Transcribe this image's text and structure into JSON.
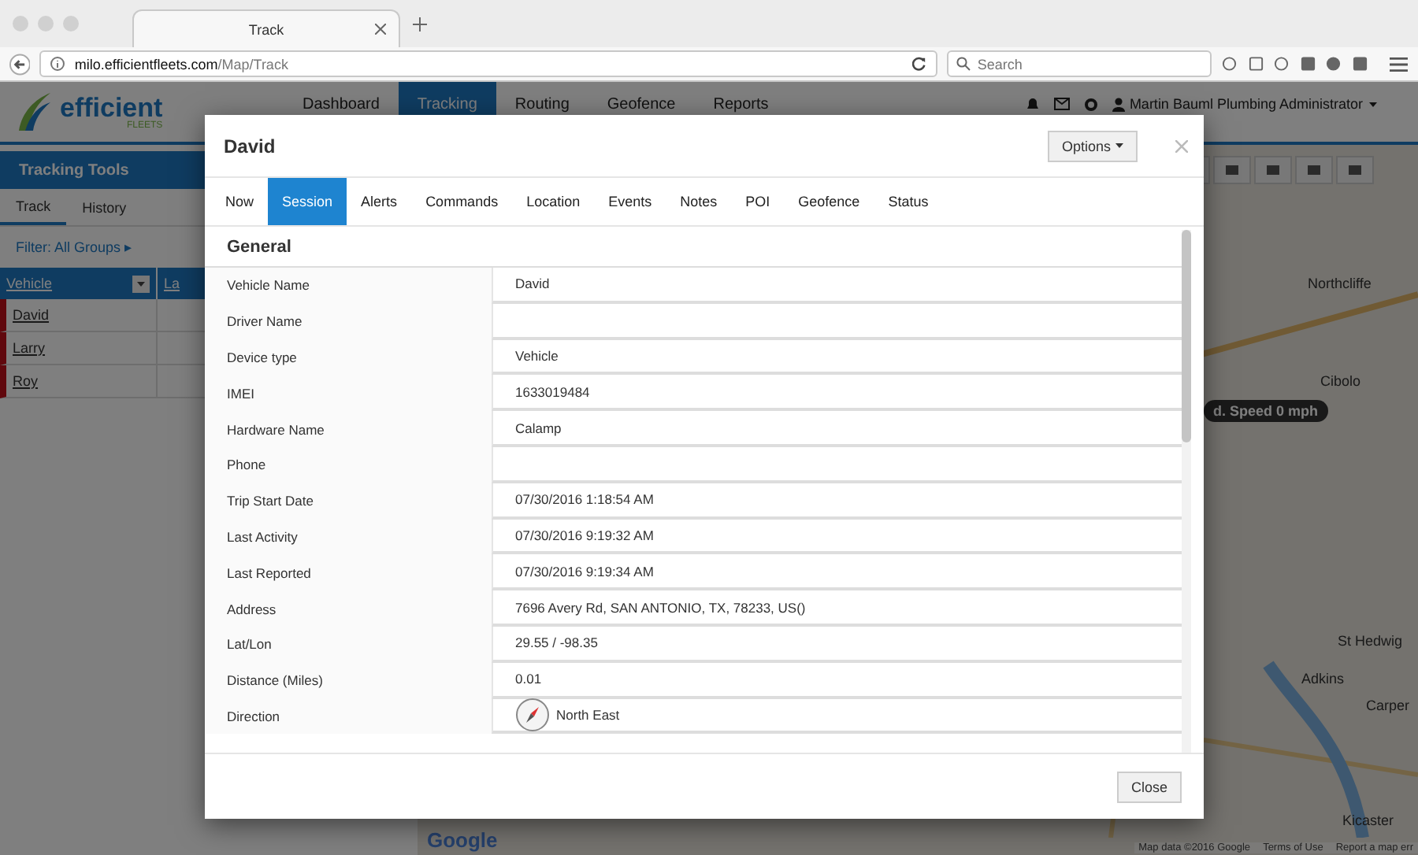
{
  "browser": {
    "tab_title": "Track",
    "url_host": "milo.efficientfleets.com",
    "url_path": "/Map/Track",
    "search_placeholder": "Search"
  },
  "app": {
    "logo": {
      "name": "efficient",
      "sub": "FLEETS"
    },
    "nav": [
      {
        "label": "Dashboard",
        "selected": false
      },
      {
        "label": "Tracking",
        "selected": true
      },
      {
        "label": "Routing",
        "selected": false
      },
      {
        "label": "Geofence",
        "selected": false
      },
      {
        "label": "Reports",
        "selected": false
      }
    ],
    "user": "Martin Bauml Plumbing Administrator"
  },
  "sidebar": {
    "title": "Tracking Tools",
    "tabs": [
      {
        "label": "Track",
        "selected": true
      },
      {
        "label": "History",
        "selected": false
      }
    ],
    "filter": "Filter: All Groups ▸",
    "columns": [
      "Vehicle",
      "La"
    ],
    "rows": [
      {
        "name": "David"
      },
      {
        "name": "Larry"
      },
      {
        "name": "Roy"
      }
    ]
  },
  "map": {
    "labels": [
      {
        "text": "Northcliffe"
      },
      {
        "text": "Cibolo"
      },
      {
        "text": "St Hedwig"
      },
      {
        "text": "Adkins"
      },
      {
        "text": "Carper"
      },
      {
        "text": "Kicaster"
      }
    ],
    "speed_label": "d. Speed 0 mph",
    "logo": "Google",
    "attribution": [
      "Map data ©2016 Google",
      "Terms of Use",
      "Report a map err"
    ]
  },
  "modal": {
    "title": "David",
    "options_button": "Options",
    "tabs": [
      {
        "label": "Now",
        "selected": false
      },
      {
        "label": "Session",
        "selected": true
      },
      {
        "label": "Alerts",
        "selected": false
      },
      {
        "label": "Commands",
        "selected": false
      },
      {
        "label": "Location",
        "selected": false
      },
      {
        "label": "Events",
        "selected": false
      },
      {
        "label": "Notes",
        "selected": false
      },
      {
        "label": "POI",
        "selected": false
      },
      {
        "label": "Geofence",
        "selected": false
      },
      {
        "label": "Status",
        "selected": false
      }
    ],
    "section_title": "General",
    "fields": [
      {
        "kind": "text",
        "label": "Vehicle Name",
        "value": "David"
      },
      {
        "kind": "text",
        "label": "Driver Name"
      },
      {
        "kind": "text",
        "label": "Device type",
        "value": "Vehicle"
      },
      {
        "kind": "text",
        "label": "IMEI",
        "value": "1633019484"
      },
      {
        "kind": "text",
        "label": "Hardware Name",
        "value": "Calamp"
      },
      {
        "kind": "text",
        "label": "Phone"
      },
      {
        "kind": "text",
        "label": "Trip Start Date",
        "value": "07/30/2016 1:18:54 AM"
      },
      {
        "kind": "text",
        "label": "Last Activity",
        "value": "07/30/2016 9:19:32 AM"
      },
      {
        "kind": "text",
        "label": "Last Reported",
        "value": "07/30/2016 9:19:34 AM"
      },
      {
        "kind": "text",
        "label": "Address",
        "value": "7696 Avery Rd, SAN ANTONIO, TX, 78233, US()"
      },
      {
        "kind": "text",
        "label": "Lat/Lon",
        "value": "29.55 / -98.35"
      },
      {
        "kind": "text",
        "label": "Distance (Miles)",
        "value": "0.01"
      },
      {
        "kind": "compass",
        "label": "Direction",
        "value": "North East"
      }
    ],
    "close_button": "Close"
  }
}
